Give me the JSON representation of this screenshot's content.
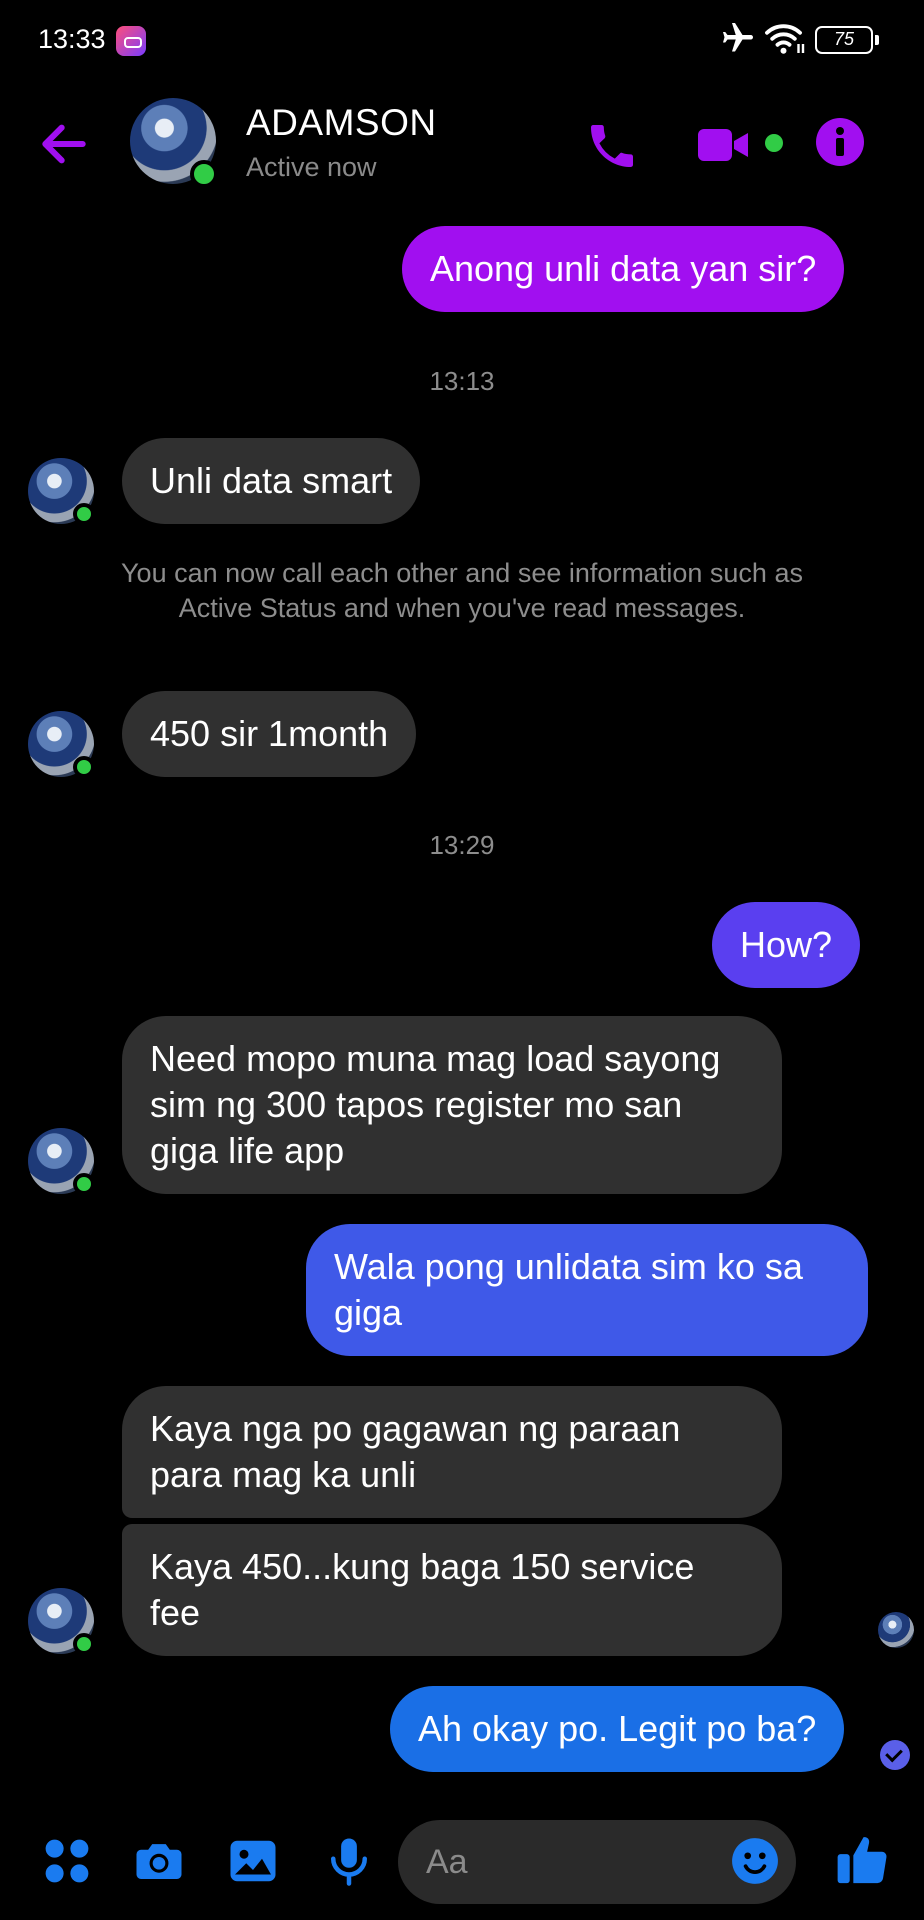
{
  "status_bar": {
    "time": "13:33",
    "battery": "75",
    "icons": [
      "app-notification-icon",
      "airplane-icon",
      "wifi-icon",
      "battery-icon"
    ]
  },
  "header": {
    "contact_name": "ADAMSON",
    "contact_status": "Active now",
    "icons": [
      "back-arrow-icon",
      "phone-icon",
      "video-camera-icon",
      "info-icon"
    ],
    "accent_color": "#a10ff0"
  },
  "messages": [
    {
      "sender": "me",
      "text": "Anong unli data yan sir?",
      "color": "#a10ff0"
    },
    {
      "timestamp": "13:13"
    },
    {
      "sender": "contact",
      "text": "Unli data smart"
    },
    {
      "system": "You can now call each other and see information such as Active Status and when you've read messages."
    },
    {
      "sender": "contact",
      "text": "450 sir 1month"
    },
    {
      "timestamp": "13:29"
    },
    {
      "sender": "me",
      "text": "How?",
      "color": "#5a3ff0"
    },
    {
      "sender": "contact",
      "text": "Need mopo muna mag load sayong sim ng 300 tapos register mo san giga life app"
    },
    {
      "sender": "me",
      "text": "Wala pong unlidata sim ko sa giga",
      "color": "#3f59e8"
    },
    {
      "sender": "contact",
      "text": "Kaya nga po gagawan ng paraan para mag ka unli"
    },
    {
      "sender": "contact",
      "text": "Kaya 450...kung baga 150 service fee"
    },
    {
      "sender": "me",
      "text": "Ah okay po. Legit po ba?",
      "color": "#1a6fe6"
    }
  ],
  "composer": {
    "placeholder": "Aa",
    "icons": [
      "menu-dots-icon",
      "camera-icon",
      "gallery-icon",
      "microphone-icon",
      "emoji-icon",
      "thumbs-up-icon"
    ],
    "icon_color": "#1a7bf0"
  }
}
